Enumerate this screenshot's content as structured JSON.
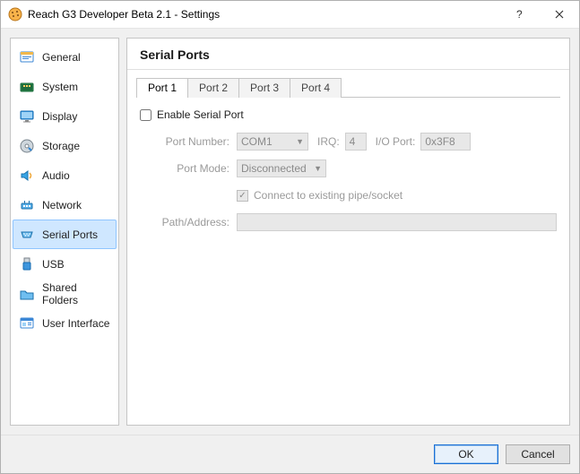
{
  "window": {
    "title": "Reach G3 Developer Beta 2.1 - Settings"
  },
  "sidebar": {
    "items": [
      {
        "label": "General"
      },
      {
        "label": "System"
      },
      {
        "label": "Display"
      },
      {
        "label": "Storage"
      },
      {
        "label": "Audio"
      },
      {
        "label": "Network"
      },
      {
        "label": "Serial Ports"
      },
      {
        "label": "USB"
      },
      {
        "label": "Shared Folders"
      },
      {
        "label": "User Interface"
      }
    ],
    "selected_index": 6
  },
  "content": {
    "heading": "Serial Ports",
    "tabs": {
      "items": [
        {
          "label": "Port 1"
        },
        {
          "label": "Port 2"
        },
        {
          "label": "Port 3"
        },
        {
          "label": "Port 4"
        }
      ],
      "active_index": 0
    },
    "form": {
      "enable_label": "Enable Serial Port",
      "enable_checked": false,
      "port_number_label": "Port Number:",
      "port_number_value": "COM1",
      "irq_label": "IRQ:",
      "irq_value": "4",
      "io_port_label": "I/O Port:",
      "io_port_value": "0x3F8",
      "port_mode_label": "Port Mode:",
      "port_mode_value": "Disconnected",
      "connect_existing_label": "Connect to existing pipe/socket",
      "connect_existing_checked": true,
      "path_address_label": "Path/Address:",
      "path_address_value": ""
    }
  },
  "footer": {
    "ok": "OK",
    "cancel": "Cancel"
  }
}
